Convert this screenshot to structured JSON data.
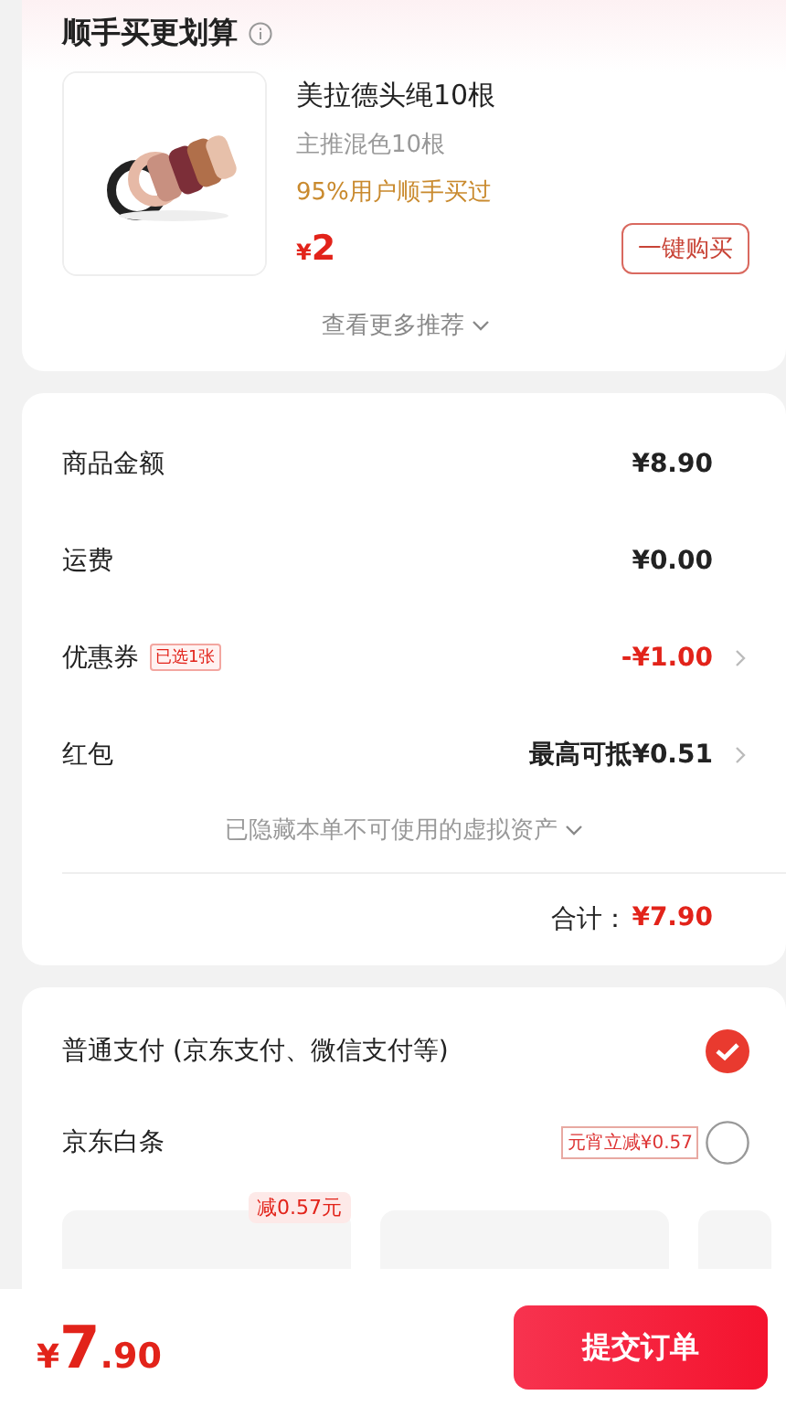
{
  "recommend": {
    "title": "顺手买更划算",
    "product": {
      "kind": "picture",
      "name": "美拉德头绳10根",
      "variant": "主推混色10根",
      "popularity": "95%用户顺手买过",
      "currency": "¥",
      "price": "2",
      "button": "一键购买"
    },
    "more": "查看更多推荐"
  },
  "summary": {
    "rows": [
      {
        "label": "商品金额",
        "value": "¥8.90",
        "highlight": false,
        "arrow": false
      },
      {
        "label": "运费",
        "value": "¥0.00",
        "highlight": false,
        "arrow": false
      },
      {
        "label": "优惠券",
        "tag": "已选1张",
        "value": "-¥1.00",
        "highlight": true,
        "arrow": true
      },
      {
        "label": "红包",
        "value": "最高可抵¥0.51",
        "highlight": false,
        "arrow": true
      }
    ],
    "hidden_note": "已隐藏本单不可使用的虚拟资产",
    "total_label": "合计：",
    "total": "¥7.90"
  },
  "payment": {
    "options": [
      {
        "label": "普通支付 (京东支付、微信支付等)",
        "selected": true
      },
      {
        "label": "京东白条",
        "badge": "元宵立减¥0.57",
        "selected": false
      }
    ],
    "installments": [
      {
        "kind": "option",
        "badge": "减0.57元"
      },
      {
        "kind": "option"
      },
      {
        "kind": "option"
      }
    ]
  },
  "bottom_bar": {
    "currency": "¥",
    "integer": "7",
    "decimal": ".90",
    "submit": "提交订单"
  }
}
